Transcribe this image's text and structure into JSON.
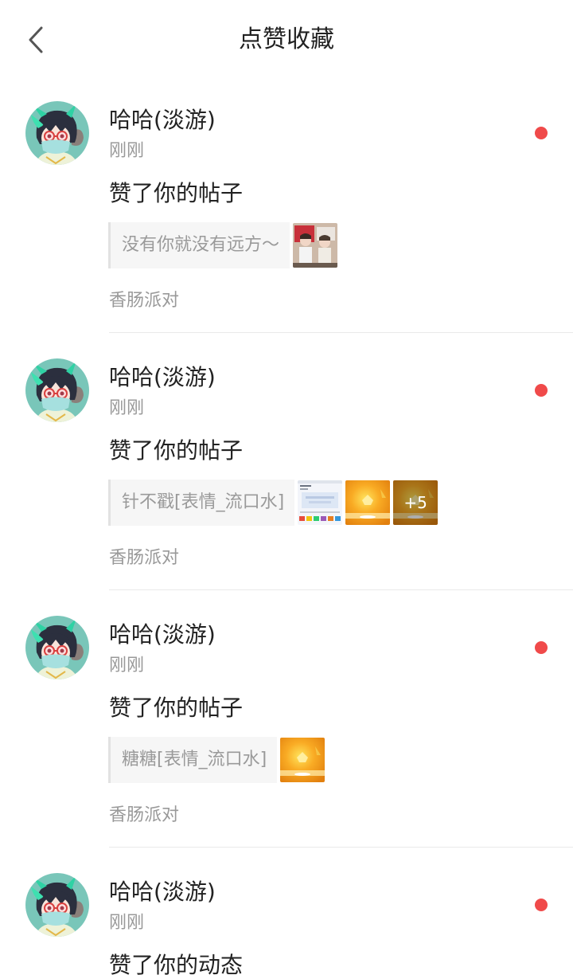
{
  "header": {
    "title": "点赞收藏",
    "back_icon": "chevron-left-icon"
  },
  "colors": {
    "unread_dot": "#f04a4a",
    "text_primary": "#222222",
    "text_secondary": "#999999"
  },
  "notifications": [
    {
      "user_name": "哈哈(淡游)",
      "time": "刚刚",
      "action": "赞了你的帖子",
      "quote": "没有你就没有远方～",
      "group": "香肠派对",
      "unread": true
    },
    {
      "user_name": "哈哈(淡游)",
      "time": "刚刚",
      "action": "赞了你的帖子",
      "quote": "针不戳[表情_流口水]",
      "more_images_label": "+5",
      "group": "香肠派对",
      "unread": true
    },
    {
      "user_name": "哈哈(淡游)",
      "time": "刚刚",
      "action": "赞了你的帖子",
      "quote": "糖糖[表情_流口水]",
      "group": "香肠派对",
      "unread": true
    },
    {
      "user_name": "哈哈(淡游)",
      "time": "刚刚",
      "action": "赞了你的动态",
      "unread": true
    }
  ]
}
